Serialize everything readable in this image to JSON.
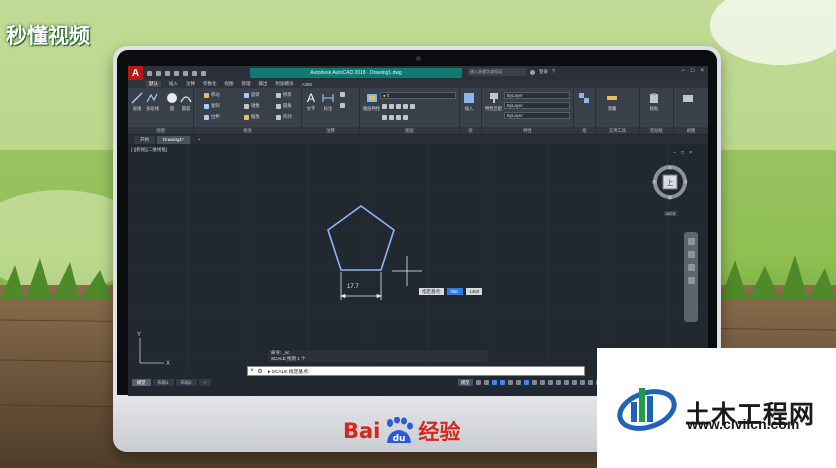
{
  "watermark_top": {
    "brand": "秒懂视频"
  },
  "monitor": {
    "brand_left": "Bai",
    "brand_mid": "du",
    "brand_right": "经验"
  },
  "watermark_civil": {
    "name": "土木工程网",
    "url": "www.civilcn.com"
  },
  "app": {
    "logo_letter": "A",
    "title": "Autodesk AutoCAD 2018 · Drawing1.dwg",
    "search_placeholder": "键入关键字或短语",
    "login": "登录",
    "window_controls": [
      "−",
      "□",
      "×"
    ]
  },
  "ribbon_tabs": [
    "默认",
    "插入",
    "注释",
    "参数化",
    "视图",
    "管理",
    "输出",
    "附加模块",
    "A360"
  ],
  "ribbon": {
    "panels": [
      "绘图",
      "修改",
      "注释",
      "图层",
      "块",
      "特性",
      "组",
      "实用工具",
      "剪贴板",
      "视图"
    ],
    "draw_tools": [
      "直线",
      "多段线",
      "圆",
      "圆弧"
    ],
    "modify_tools": [
      "移动",
      "旋转",
      "修剪",
      "复制",
      "镜像",
      "圆角",
      "拉伸",
      "缩放",
      "阵列"
    ],
    "annotation_tools": [
      "文字",
      "标注"
    ],
    "layer_tools": [
      "图层特性"
    ],
    "block_tools": [
      "插入"
    ],
    "property_tools": [
      "特性匹配"
    ],
    "util_tools": [
      "测量"
    ],
    "clip_tools": [
      "粘贴"
    ],
    "bylayer": "ByLayer",
    "layer_value": "0"
  },
  "file_tabs": [
    "开始",
    "Drawing1*"
  ],
  "view_label": "[-][俯视][二维线框]",
  "viewcube": {
    "face": "上",
    "compass": [
      "北",
      "南",
      "东",
      "西"
    ],
    "wcs": "WCS"
  },
  "dimension_value": "17.7",
  "tooltip": {
    "label": "指定基点:",
    "value1": "350",
    "value2": "1450"
  },
  "command": {
    "history": [
      "命令: _sc",
      "SCALE 找到 1 个"
    ],
    "prompt": "▸ SCALE 指定基点:"
  },
  "layout_tabs": [
    "模型",
    "布局1",
    "布局2"
  ],
  "status": {
    "model": "模型"
  }
}
